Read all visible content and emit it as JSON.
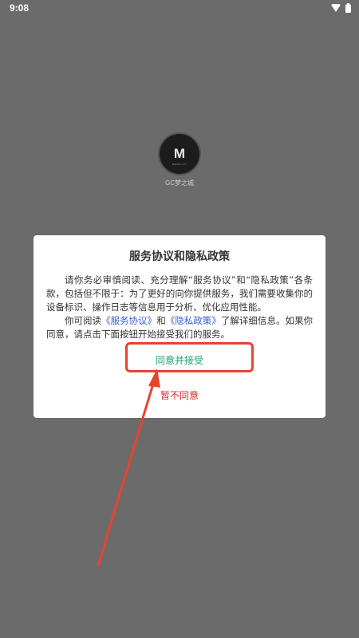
{
  "status_bar": {
    "time": "9:08",
    "icons": [
      "wifi-icon",
      "battery-icon"
    ]
  },
  "app": {
    "logo_text": "M",
    "logo_subtext": "MOUNT CITY",
    "name": "GC梦之城"
  },
  "dialog": {
    "title": "服务协议和隐私政策",
    "paragraph1": "请你务必审慎阅读、充分理解“服务协议”和“隐私政策”各条款，包括但不限于：为了更好的向你提供服务，我们需要收集你的设备标识、操作日志等信息用于分析、优化应用性能。",
    "paragraph2_prefix": "你可阅读",
    "link_service": "《服务协议》",
    "paragraph2_and": "和",
    "link_privacy": "《隐私政策》",
    "paragraph2_suffix": "了解详细信息。如果你同意，请点击下面按钮开始接受我们的服务。",
    "accept_label": "同意并接受",
    "decline_label": "暂不同意"
  },
  "colors": {
    "overlay": "#6b6b6b",
    "accept": "#1aa37a",
    "decline": "#d92e2e",
    "link": "#3a5bd9",
    "annotation": "#e8432d"
  }
}
